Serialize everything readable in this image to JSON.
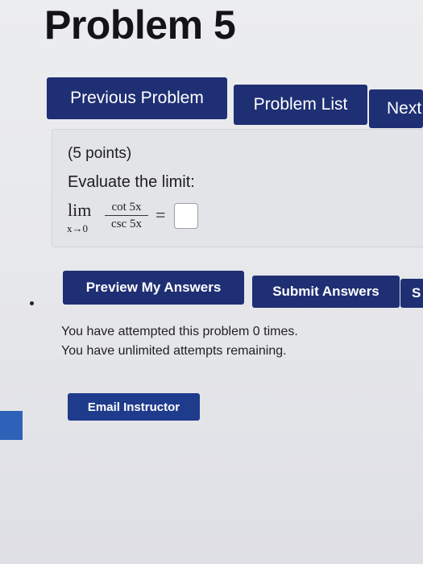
{
  "page": {
    "title": "Problem 5"
  },
  "nav": {
    "previous_label": "Previous Problem",
    "list_label": "Problem List",
    "next_label": "Next"
  },
  "problem": {
    "points": "(5 points)",
    "prompt": "Evaluate the limit:",
    "limit_word": "lim",
    "limit_sub": "x→0",
    "numerator": "cot 5x",
    "denominator": "csc 5x",
    "equals": "=",
    "answer_value": ""
  },
  "actions": {
    "preview_label": "Preview My Answers",
    "submit_label": "Submit Answers",
    "show_label": "S"
  },
  "status": {
    "attempted": "You have attempted this problem 0 times.",
    "remaining": "You have unlimited attempts remaining."
  },
  "email": {
    "label": "Email Instructor"
  },
  "colors": {
    "button_bg": "#1f2f74",
    "accent": "#2e62b8"
  }
}
